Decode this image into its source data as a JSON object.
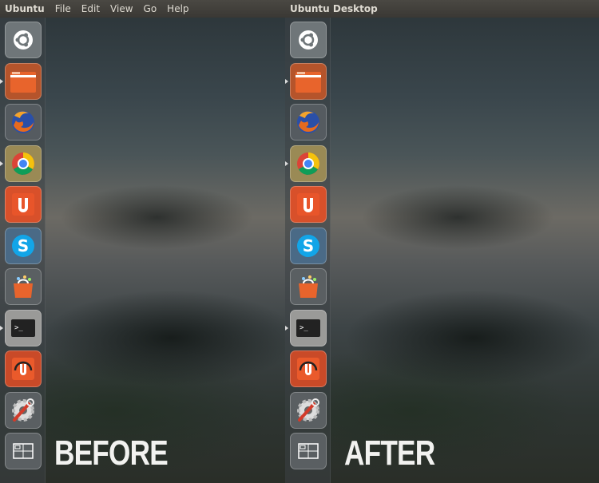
{
  "before": {
    "menubar": {
      "title": "Ubuntu",
      "menus": [
        "File",
        "Edit",
        "View",
        "Go",
        "Help"
      ]
    },
    "caption": "BEFORE"
  },
  "after": {
    "menubar": {
      "title": "Ubuntu Desktop"
    },
    "caption": "AFTER"
  },
  "launcher": {
    "icons": [
      "ubuntu-dash-icon",
      "files-folder-icon",
      "firefox-icon",
      "chrome-icon",
      "ubuntu-one-icon",
      "skype-icon",
      "software-center-icon",
      "terminal-icon",
      "ubuntu-one-music-icon",
      "system-settings-icon",
      "workspace-switcher-icon"
    ],
    "running": [
      1,
      3,
      7
    ]
  },
  "colors": {
    "accent": "#e0542a",
    "panel": "#3d3b37"
  }
}
